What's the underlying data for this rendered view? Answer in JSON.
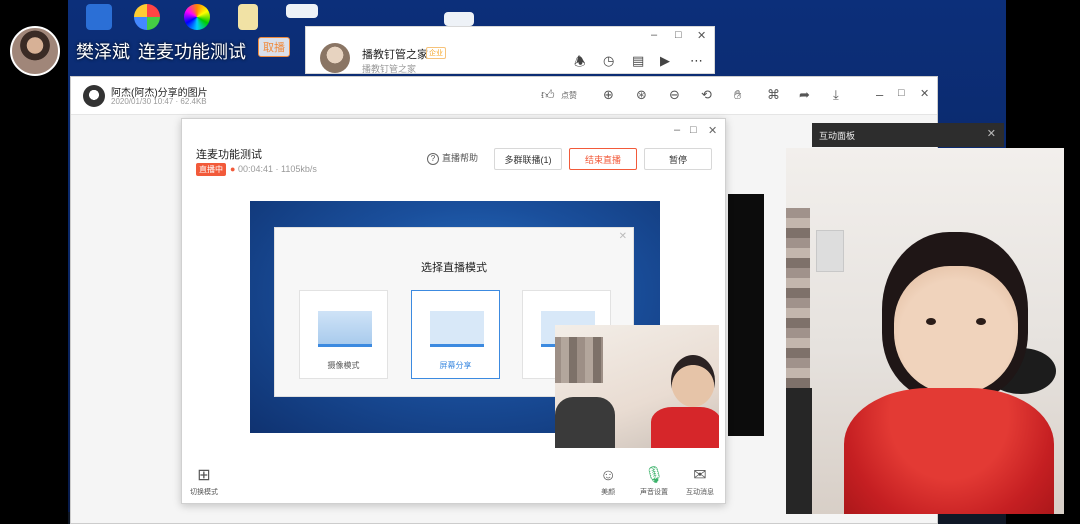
{
  "presenter": {
    "name": "樊泽斌",
    "title": "连麦功能测试",
    "follow_label": "取播"
  },
  "chat_window": {
    "title": "播教钉管之家",
    "tag": "企业",
    "subtitle": "播教钉管之家",
    "controls": [
      "–",
      "□",
      "✕"
    ],
    "icons": [
      "loudspeaker-icon",
      "clock-icon",
      "folder-icon",
      "video-icon",
      "more-icon"
    ]
  },
  "viewer": {
    "title": "阿杰(阿杰)分享的图片",
    "meta": "2020/01/30 10:47 · 62.4KB",
    "like_label": "点赞",
    "tools": [
      "zoom-in-icon",
      "zoom-fit-icon",
      "zoom-out-icon",
      "rotate-icon",
      "hand-icon",
      "crop-icon",
      "share-icon",
      "download-icon"
    ],
    "controls": [
      "–",
      "□",
      "✕"
    ]
  },
  "live": {
    "title": "连麦功能测试",
    "status_badge": "直播中",
    "duration": "00:04:41",
    "bitrate": "1105kb/s",
    "help_label": "直播帮助",
    "buttons": {
      "multi_link": "多群联播(1)",
      "end_live": "结束直播",
      "more": "暂停"
    },
    "controls": [
      "–",
      "□",
      "✕"
    ],
    "dialog": {
      "title": "选择直播模式",
      "modes": [
        {
          "label": "摄像模式",
          "selected": false
        },
        {
          "label": "屏幕分享",
          "selected": true
        },
        {
          "label": "",
          "selected": false
        }
      ]
    },
    "footer": {
      "switch_mode": "切换模式",
      "beauty": "美颜",
      "audio": "声音设置",
      "interact": "互动消息"
    }
  },
  "interaction_panel": {
    "title": "互动面板",
    "close": "✕"
  },
  "colors": {
    "accent_red": "#f25a3a",
    "accent_blue": "#3c8ae0",
    "panel_dark": "#2d2d2d"
  }
}
